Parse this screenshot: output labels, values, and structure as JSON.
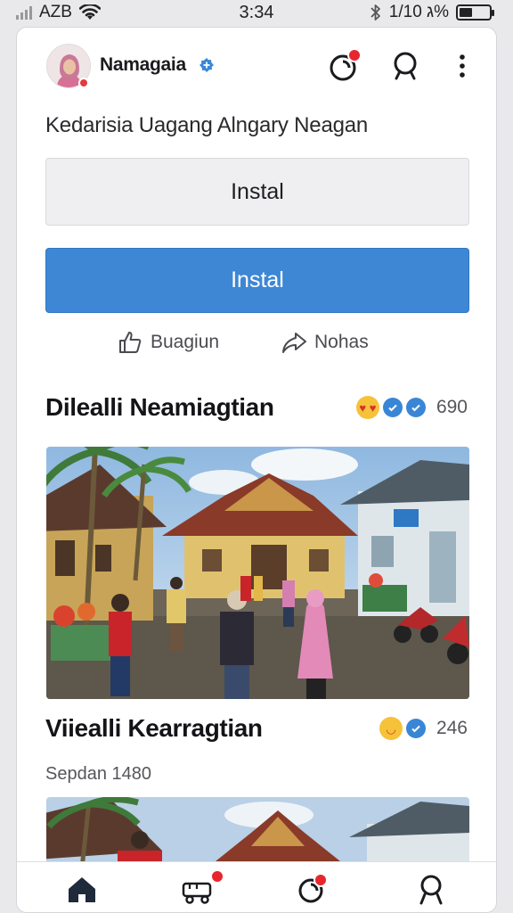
{
  "status_bar": {
    "carrier": "AZB",
    "time": "3:34",
    "right_text": "1/10 ג%"
  },
  "header": {
    "username": "Namagaia",
    "icons": [
      "notification-icon",
      "search-icon",
      "more-vertical-icon"
    ]
  },
  "post": {
    "subtitle": "Kedarisia  Uagang Alngary Neagan",
    "primary_button_label": "Instal",
    "secondary_button_label": "Instal",
    "like_label": "Buagiun",
    "share_label": "Nohas"
  },
  "sections": [
    {
      "title": "Dilealli Neamiagtian",
      "reaction_count": "690",
      "reactions": [
        "heart-eyes-emoji",
        "check-badge",
        "check-badge"
      ]
    },
    {
      "title": "Viiealli Kearragtian",
      "caption": "Sepdan 1480",
      "reaction_count": "246",
      "reactions": [
        "surprised-emoji",
        "check-badge"
      ]
    }
  ],
  "bottom_nav": {
    "items": [
      "home-icon",
      "delivery-icon",
      "notification-icon",
      "profile-icon"
    ]
  },
  "colors": {
    "accent": "#3d87d4",
    "badge": "#e7262e",
    "verified": "#3a86d6"
  }
}
